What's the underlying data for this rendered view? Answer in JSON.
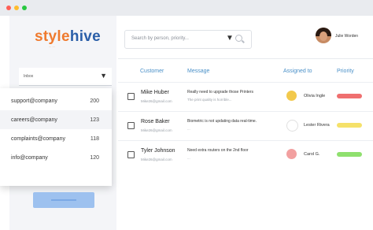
{
  "window": {
    "dots": [
      "#ff5f57",
      "#febc2e",
      "#28c840"
    ]
  },
  "brand": {
    "logo_part1": "style",
    "logo_part2": "hive",
    "tagline": "... ...",
    "colors": {
      "orange": "#ef7a2e",
      "blue": "#2b5fa8"
    }
  },
  "inbox": {
    "selected": "Inbox",
    "options": [
      {
        "email": "support@company",
        "count": "200"
      },
      {
        "email": "careers@company",
        "count": "123"
      },
      {
        "email": "complaints@company",
        "count": "118"
      },
      {
        "email": "info@company",
        "count": "120"
      }
    ]
  },
  "search": {
    "placeholder": "Search by person, priority..."
  },
  "user": {
    "name": "Julie Worden"
  },
  "table": {
    "headers": {
      "customer": "Customer",
      "message": "Message",
      "assigned": "Assigned to",
      "priority": "Priority"
    },
    "rows": [
      {
        "customer": "Mike Huber",
        "email": "Mike26@gmail.com",
        "subject": "Really need to upgrade those Printers",
        "preview": "The print quality is horrible...",
        "agent": "Olivia Ingle",
        "agent_avatar_color": "#f2c94c",
        "priority_color": "#ef6f6f",
        "priority_level": "high"
      },
      {
        "customer": "Rose Baker",
        "email": "Mike26@gmail.com",
        "subject": "Biometric is not updating data real-time.",
        "preview": "...",
        "agent": "Lester Rivera",
        "agent_avatar_color": "#ffffff",
        "priority_color": "#f5e16a",
        "priority_level": "medium"
      },
      {
        "customer": "Tyler Johnson",
        "email": "Mike26@gmail.com",
        "subject": "Need extra routers on the 2nd floor",
        "preview": "...",
        "agent": "Carol G.",
        "agent_avatar_color": "#f2a0a0",
        "priority_color": "#8fe06e",
        "priority_level": "low"
      }
    ]
  }
}
